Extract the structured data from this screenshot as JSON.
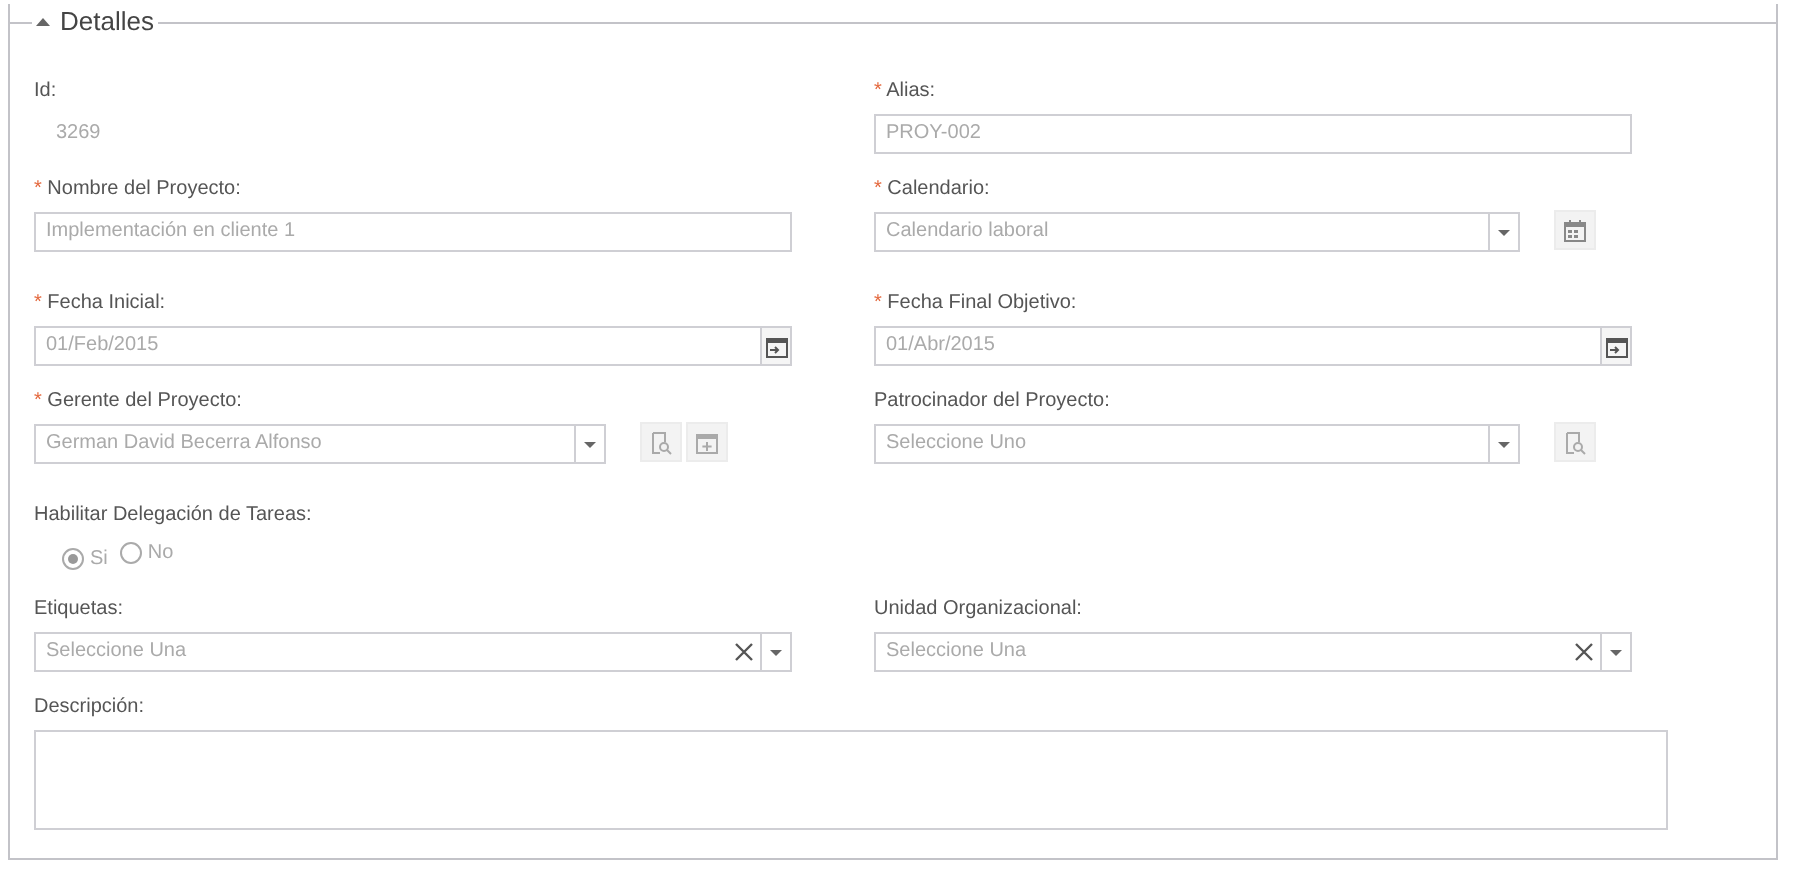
{
  "section": {
    "title": "Detalles",
    "expanded": true
  },
  "rows": [
    [
      {
        "kind": "static",
        "label": "Id:",
        "value": "3269"
      },
      {
        "kind": "input",
        "required_mark": "*",
        "label": "Alias:",
        "value": "PROY-002"
      }
    ],
    [
      {
        "kind": "input",
        "required_mark": "*",
        "label": "Nombre del Proyecto:",
        "value": "Implementación en cliente 1"
      },
      {
        "kind": "select",
        "required_mark": "*",
        "label": "Calendario:",
        "value": "Calendario laboral",
        "tools": [
          {
            "kind": "calendar"
          }
        ]
      }
    ],
    [
      {
        "kind": "date",
        "required_mark": "*",
        "label": "Fecha Inicial:",
        "value": "01/Feb/2015"
      },
      {
        "kind": "date",
        "required_mark": "*",
        "label": "Fecha Final Objetivo:",
        "value": "01/Abr/2015"
      }
    ],
    [
      {
        "kind": "select",
        "required_mark": "*",
        "label": "Gerente del Proyecto:",
        "value": "German David Becerra Alfonso",
        "tools": [
          {
            "kind": "lookup"
          },
          {
            "kind": "add"
          }
        ]
      },
      {
        "kind": "select",
        "label": "Patrocinador del Proyecto:",
        "placeholder": "Seleccione Uno",
        "tools": [
          {
            "kind": "lookup"
          }
        ]
      }
    ],
    [
      {
        "kind": "radio",
        "label": "Habilitar Delegación de Tareas:",
        "options": [
          {
            "label": "Si",
            "selected": true
          },
          {
            "label": "No",
            "selected": false
          }
        ]
      }
    ],
    [
      {
        "kind": "select",
        "label": "Etiquetas:",
        "placeholder": "Seleccione Una",
        "clearable": true
      },
      {
        "kind": "select",
        "label": "Unidad Organizacional:",
        "placeholder": "Seleccione Una",
        "clearable": true
      }
    ],
    [
      {
        "kind": "textarea",
        "label": "Descripción:"
      }
    ]
  ]
}
